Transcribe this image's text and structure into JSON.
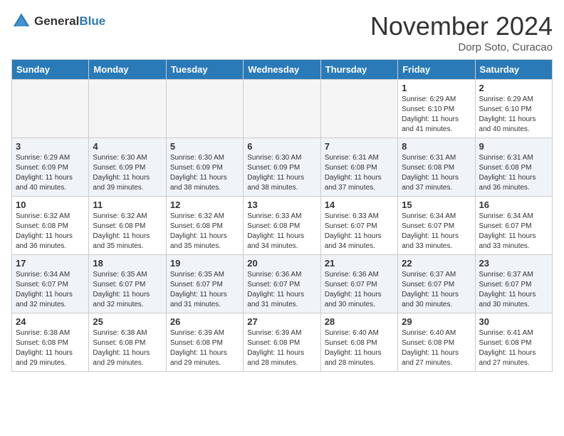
{
  "logo": {
    "text_general": "General",
    "text_blue": "Blue",
    "tagline": ""
  },
  "header": {
    "month_year": "November 2024",
    "location": "Dorp Soto, Curacao"
  },
  "days_of_week": [
    "Sunday",
    "Monday",
    "Tuesday",
    "Wednesday",
    "Thursday",
    "Friday",
    "Saturday"
  ],
  "weeks": [
    {
      "row_class": "row-odd",
      "days": [
        {
          "num": "",
          "info": "",
          "empty": true
        },
        {
          "num": "",
          "info": "",
          "empty": true
        },
        {
          "num": "",
          "info": "",
          "empty": true
        },
        {
          "num": "",
          "info": "",
          "empty": true
        },
        {
          "num": "",
          "info": "",
          "empty": true
        },
        {
          "num": "1",
          "info": "Sunrise: 6:29 AM\nSunset: 6:10 PM\nDaylight: 11 hours and 41 minutes.",
          "empty": false
        },
        {
          "num": "2",
          "info": "Sunrise: 6:29 AM\nSunset: 6:10 PM\nDaylight: 11 hours and 40 minutes.",
          "empty": false
        }
      ]
    },
    {
      "row_class": "row-even",
      "days": [
        {
          "num": "3",
          "info": "Sunrise: 6:29 AM\nSunset: 6:09 PM\nDaylight: 11 hours and 40 minutes.",
          "empty": false
        },
        {
          "num": "4",
          "info": "Sunrise: 6:30 AM\nSunset: 6:09 PM\nDaylight: 11 hours and 39 minutes.",
          "empty": false
        },
        {
          "num": "5",
          "info": "Sunrise: 6:30 AM\nSunset: 6:09 PM\nDaylight: 11 hours and 38 minutes.",
          "empty": false
        },
        {
          "num": "6",
          "info": "Sunrise: 6:30 AM\nSunset: 6:09 PM\nDaylight: 11 hours and 38 minutes.",
          "empty": false
        },
        {
          "num": "7",
          "info": "Sunrise: 6:31 AM\nSunset: 6:08 PM\nDaylight: 11 hours and 37 minutes.",
          "empty": false
        },
        {
          "num": "8",
          "info": "Sunrise: 6:31 AM\nSunset: 6:08 PM\nDaylight: 11 hours and 37 minutes.",
          "empty": false
        },
        {
          "num": "9",
          "info": "Sunrise: 6:31 AM\nSunset: 6:08 PM\nDaylight: 11 hours and 36 minutes.",
          "empty": false
        }
      ]
    },
    {
      "row_class": "row-odd",
      "days": [
        {
          "num": "10",
          "info": "Sunrise: 6:32 AM\nSunset: 6:08 PM\nDaylight: 11 hours and 36 minutes.",
          "empty": false
        },
        {
          "num": "11",
          "info": "Sunrise: 6:32 AM\nSunset: 6:08 PM\nDaylight: 11 hours and 35 minutes.",
          "empty": false
        },
        {
          "num": "12",
          "info": "Sunrise: 6:32 AM\nSunset: 6:08 PM\nDaylight: 11 hours and 35 minutes.",
          "empty": false
        },
        {
          "num": "13",
          "info": "Sunrise: 6:33 AM\nSunset: 6:08 PM\nDaylight: 11 hours and 34 minutes.",
          "empty": false
        },
        {
          "num": "14",
          "info": "Sunrise: 6:33 AM\nSunset: 6:07 PM\nDaylight: 11 hours and 34 minutes.",
          "empty": false
        },
        {
          "num": "15",
          "info": "Sunrise: 6:34 AM\nSunset: 6:07 PM\nDaylight: 11 hours and 33 minutes.",
          "empty": false
        },
        {
          "num": "16",
          "info": "Sunrise: 6:34 AM\nSunset: 6:07 PM\nDaylight: 11 hours and 33 minutes.",
          "empty": false
        }
      ]
    },
    {
      "row_class": "row-even",
      "days": [
        {
          "num": "17",
          "info": "Sunrise: 6:34 AM\nSunset: 6:07 PM\nDaylight: 11 hours and 32 minutes.",
          "empty": false
        },
        {
          "num": "18",
          "info": "Sunrise: 6:35 AM\nSunset: 6:07 PM\nDaylight: 11 hours and 32 minutes.",
          "empty": false
        },
        {
          "num": "19",
          "info": "Sunrise: 6:35 AM\nSunset: 6:07 PM\nDaylight: 11 hours and 31 minutes.",
          "empty": false
        },
        {
          "num": "20",
          "info": "Sunrise: 6:36 AM\nSunset: 6:07 PM\nDaylight: 11 hours and 31 minutes.",
          "empty": false
        },
        {
          "num": "21",
          "info": "Sunrise: 6:36 AM\nSunset: 6:07 PM\nDaylight: 11 hours and 30 minutes.",
          "empty": false
        },
        {
          "num": "22",
          "info": "Sunrise: 6:37 AM\nSunset: 6:07 PM\nDaylight: 11 hours and 30 minutes.",
          "empty": false
        },
        {
          "num": "23",
          "info": "Sunrise: 6:37 AM\nSunset: 6:07 PM\nDaylight: 11 hours and 30 minutes.",
          "empty": false
        }
      ]
    },
    {
      "row_class": "row-odd",
      "days": [
        {
          "num": "24",
          "info": "Sunrise: 6:38 AM\nSunset: 6:08 PM\nDaylight: 11 hours and 29 minutes.",
          "empty": false
        },
        {
          "num": "25",
          "info": "Sunrise: 6:38 AM\nSunset: 6:08 PM\nDaylight: 11 hours and 29 minutes.",
          "empty": false
        },
        {
          "num": "26",
          "info": "Sunrise: 6:39 AM\nSunset: 6:08 PM\nDaylight: 11 hours and 29 minutes.",
          "empty": false
        },
        {
          "num": "27",
          "info": "Sunrise: 6:39 AM\nSunset: 6:08 PM\nDaylight: 11 hours and 28 minutes.",
          "empty": false
        },
        {
          "num": "28",
          "info": "Sunrise: 6:40 AM\nSunset: 6:08 PM\nDaylight: 11 hours and 28 minutes.",
          "empty": false
        },
        {
          "num": "29",
          "info": "Sunrise: 6:40 AM\nSunset: 6:08 PM\nDaylight: 11 hours and 27 minutes.",
          "empty": false
        },
        {
          "num": "30",
          "info": "Sunrise: 6:41 AM\nSunset: 6:08 PM\nDaylight: 11 hours and 27 minutes.",
          "empty": false
        }
      ]
    }
  ]
}
